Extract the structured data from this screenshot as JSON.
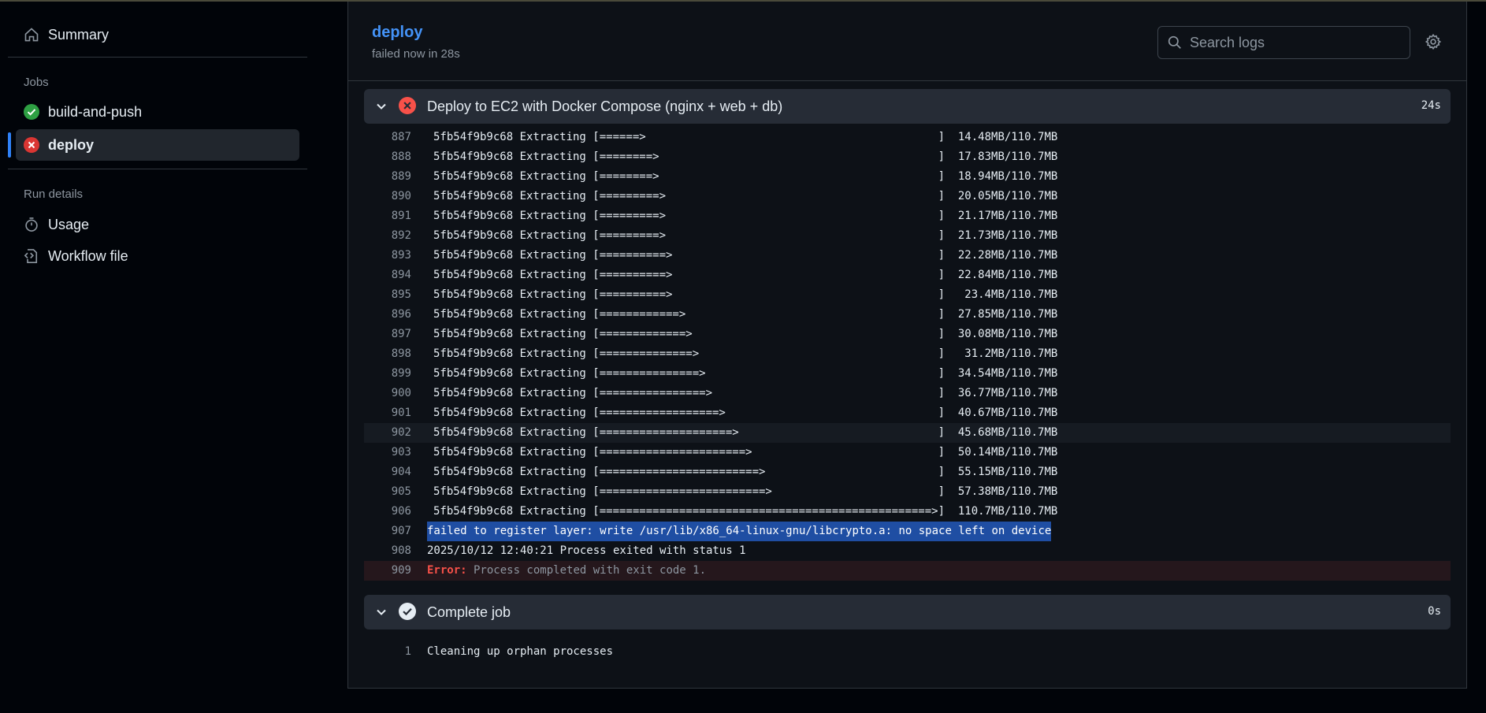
{
  "sidebar": {
    "summary_label": "Summary",
    "jobs_heading": "Jobs",
    "jobs": [
      {
        "label": "build-and-push",
        "status": "success"
      },
      {
        "label": "deploy",
        "status": "failure"
      }
    ],
    "run_details_heading": "Run details",
    "usage_label": "Usage",
    "workflow_file_label": "Workflow file"
  },
  "header": {
    "title": "deploy",
    "subtitle": "failed now in 28s",
    "search_placeholder": "Search logs"
  },
  "steps": [
    {
      "title": "Deploy to EC2 with Docker Compose (nginx + web + db)",
      "duration": "24s",
      "status": "failure"
    },
    {
      "title": "Complete job",
      "duration": "0s",
      "status": "success"
    }
  ],
  "log_lines": [
    {
      "n": "887",
      "text": "5fb54f9b9c68 Extracting [======>                                            ]  14.48MB/110.7MB"
    },
    {
      "n": "888",
      "text": "5fb54f9b9c68 Extracting [========>                                          ]  17.83MB/110.7MB"
    },
    {
      "n": "889",
      "text": "5fb54f9b9c68 Extracting [========>                                          ]  18.94MB/110.7MB"
    },
    {
      "n": "890",
      "text": "5fb54f9b9c68 Extracting [=========>                                         ]  20.05MB/110.7MB"
    },
    {
      "n": "891",
      "text": "5fb54f9b9c68 Extracting [=========>                                         ]  21.17MB/110.7MB"
    },
    {
      "n": "892",
      "text": "5fb54f9b9c68 Extracting [=========>                                         ]  21.73MB/110.7MB"
    },
    {
      "n": "893",
      "text": "5fb54f9b9c68 Extracting [==========>                                        ]  22.28MB/110.7MB"
    },
    {
      "n": "894",
      "text": "5fb54f9b9c68 Extracting [==========>                                        ]  22.84MB/110.7MB"
    },
    {
      "n": "895",
      "text": "5fb54f9b9c68 Extracting [==========>                                        ]   23.4MB/110.7MB"
    },
    {
      "n": "896",
      "text": "5fb54f9b9c68 Extracting [============>                                      ]  27.85MB/110.7MB"
    },
    {
      "n": "897",
      "text": "5fb54f9b9c68 Extracting [=============>                                     ]  30.08MB/110.7MB"
    },
    {
      "n": "898",
      "text": "5fb54f9b9c68 Extracting [==============>                                    ]   31.2MB/110.7MB"
    },
    {
      "n": "899",
      "text": "5fb54f9b9c68 Extracting [===============>                                   ]  34.54MB/110.7MB"
    },
    {
      "n": "900",
      "text": "5fb54f9b9c68 Extracting [================>                                  ]  36.77MB/110.7MB"
    },
    {
      "n": "901",
      "text": "5fb54f9b9c68 Extracting [==================>                                ]  40.67MB/110.7MB"
    },
    {
      "n": "902",
      "text": "5fb54f9b9c68 Extracting [====================>                              ]  45.68MB/110.7MB"
    },
    {
      "n": "903",
      "text": "5fb54f9b9c68 Extracting [======================>                            ]  50.14MB/110.7MB"
    },
    {
      "n": "904",
      "text": "5fb54f9b9c68 Extracting [========================>                          ]  55.15MB/110.7MB"
    },
    {
      "n": "905",
      "text": "5fb54f9b9c68 Extracting [=========================>                         ]  57.38MB/110.7MB"
    },
    {
      "n": "906",
      "text": "5fb54f9b9c68 Extracting [==================================================>]  110.7MB/110.7MB"
    },
    {
      "n": "907",
      "text": "failed to register layer: write /usr/lib/x86_64-linux-gnu/libcrypto.a: no space left on device"
    },
    {
      "n": "908",
      "text": "2025/10/12 12:40:21 Process exited with status 1"
    },
    {
      "n": "909",
      "error_label": "Error:",
      "error_text": " Process completed with exit code 1."
    }
  ],
  "complete_job_lines": [
    {
      "n": "1",
      "text": "Cleaning up orphan processes"
    }
  ]
}
